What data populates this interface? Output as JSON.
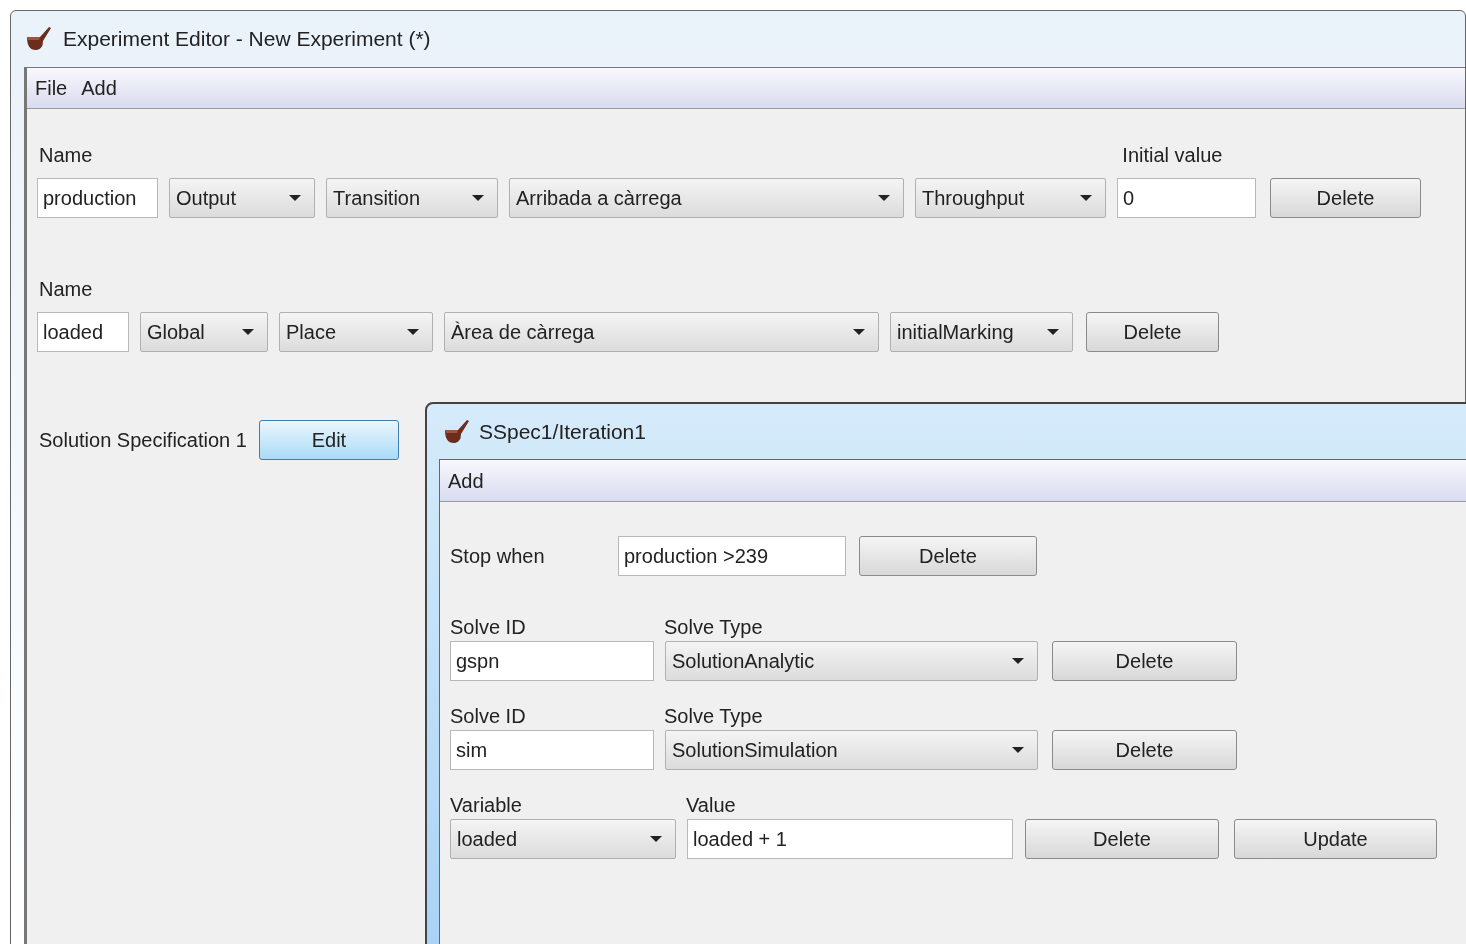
{
  "window": {
    "title": "Experiment Editor - New Experiment (*)"
  },
  "menu": [
    "File",
    "Add"
  ],
  "variable_rows": [
    {
      "name_label": "Name",
      "value_label": "Initial value",
      "name": "production",
      "selects": [
        "Output",
        "Transition",
        "Arribada a càrrega",
        "Throughput"
      ],
      "initial_value": "0",
      "button": "Delete"
    },
    {
      "name_label": "Name",
      "name": "loaded",
      "selects": [
        "Global",
        "Place",
        "Àrea de càrrega",
        "initialMarking"
      ],
      "button": "Delete"
    }
  ],
  "solution_spec": {
    "label": "Solution Specification 1",
    "button": "Edit"
  },
  "dialog": {
    "title": "SSpec1/Iteration1",
    "menu": [
      "Add"
    ],
    "stop_when": {
      "label": "Stop when",
      "value": "production >239",
      "button": "Delete"
    },
    "solves": [
      {
        "id_label": "Solve ID",
        "type_label": "Solve Type",
        "id": "gspn",
        "type": "SolutionAnalytic",
        "button": "Delete"
      },
      {
        "id_label": "Solve ID",
        "type_label": "Solve Type",
        "id": "sim",
        "type": "SolutionSimulation",
        "button": "Delete"
      }
    ],
    "assignment": {
      "variable_label": "Variable",
      "value_label": "Value",
      "variable": "loaded",
      "value": "loaded + 1",
      "buttons": [
        "Delete",
        "Update"
      ]
    }
  }
}
